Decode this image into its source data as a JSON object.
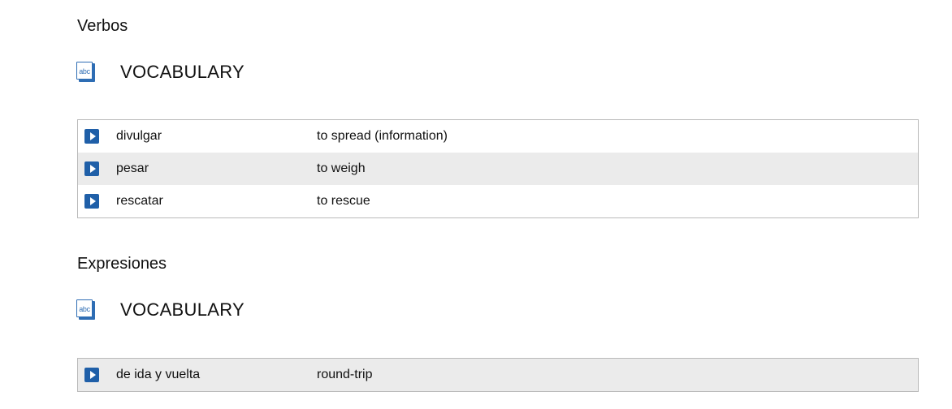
{
  "sections": [
    {
      "heading": "Verbos",
      "vocab_label": "VOCABULARY",
      "icon": "abc-book-icon",
      "rows": [
        {
          "term": "divulgar",
          "definition": "to spread (information)",
          "shaded": false
        },
        {
          "term": "pesar",
          "definition": "to weigh",
          "shaded": true
        },
        {
          "term": "rescatar",
          "definition": "to rescue",
          "shaded": false
        }
      ]
    },
    {
      "heading": "Expresiones",
      "vocab_label": "VOCABULARY",
      "icon": "abc-book-icon",
      "rows": [
        {
          "term": "de ida y vuelta",
          "definition": "round-trip",
          "shaded": true
        }
      ]
    }
  ],
  "icon_text": "abc",
  "colors": {
    "accent": "#1f5fa8",
    "row_shade": "#ebebeb",
    "border": "#b9b9b9"
  }
}
